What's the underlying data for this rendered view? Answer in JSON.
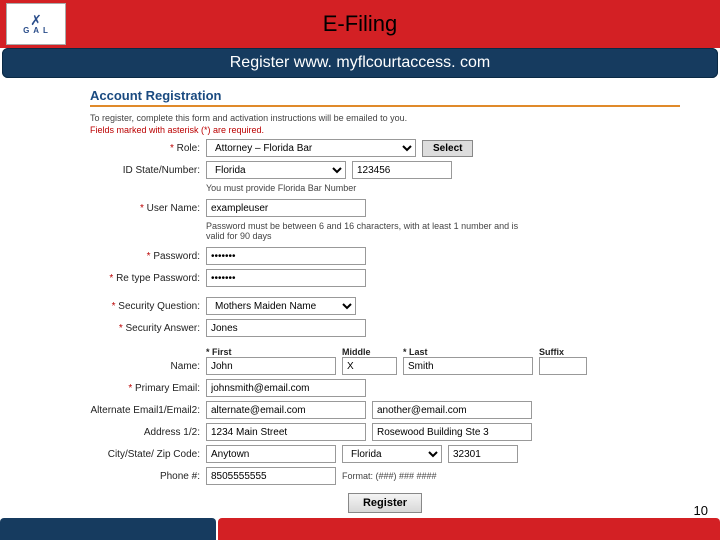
{
  "header": {
    "title": "E-Filing",
    "logo_text": "G A L",
    "logo_sub": ""
  },
  "subheader": {
    "text": "Register www. myflcourtaccess. com"
  },
  "form": {
    "section_title": "Account Registration",
    "instructions": "To register, complete this form and activation instructions will be emailed to you.",
    "required_note": "Fields marked with asterisk (*) are required.",
    "role_label": "Role:",
    "role_value": "Attorney – Florida Bar",
    "select_btn": "Select",
    "idstate_label": "ID State/Number:",
    "idstate_value": "Florida",
    "idnum_value": "123456",
    "id_note": "You must provide Florida Bar Number",
    "username_label": "User Name:",
    "username_value": "exampleuser",
    "pw_note": "Password must be between 6 and 16 characters, with at least 1 number and is valid for 90 days",
    "password_label": "Password:",
    "password_value": "•••••••",
    "repassword_label": "Re type Password:",
    "repassword_value": "•••••••",
    "secq_label": "Security Question:",
    "secq_value": "Mothers Maiden Name",
    "seca_label": "Security Answer:",
    "seca_value": "Jones",
    "nh_first": "First",
    "nh_middle": "Middle",
    "nh_last": "Last",
    "nh_suffix": "Suffix",
    "name_label": "Name:",
    "name_first": "John",
    "name_middle": "X",
    "name_last": "Smith",
    "name_suffix": "",
    "pemail_label": "Primary Email:",
    "pemail_value": "johnsmith@email.com",
    "aemail_label": "Alternate Email1/Email2:",
    "aemail1": "alternate@email.com",
    "aemail2": "another@email.com",
    "addr_label": "Address 1/2:",
    "addr1": "1234 Main Street",
    "addr2": "Rosewood Building Ste 3",
    "csz_label": "City/State/ Zip Code:",
    "city": "Anytown",
    "state": "Florida",
    "zip": "32301",
    "phone_label": "Phone #:",
    "phone_value": "8505555555",
    "phone_format": "Format: (###) ### ####",
    "register_btn": "Register"
  },
  "page_number": "10"
}
